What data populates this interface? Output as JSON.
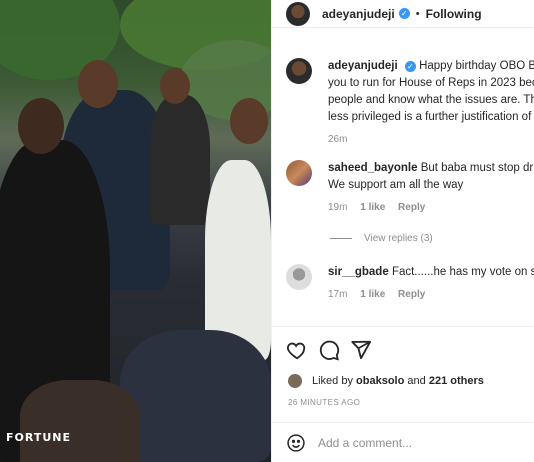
{
  "photo": {
    "watermark": "FORTUNE"
  },
  "header": {
    "username": "adeyanjudeji",
    "dot": "•",
    "follow_status": "Following"
  },
  "caption": {
    "username": "adeyanjudeji",
    "lines": [
      "Happy birthday OBO Bac",
      "you to run for House of Reps in 2023 bec",
      "people and know what the issues are. The",
      "less privileged is a further justification of"
    ],
    "time": "26m"
  },
  "comments": [
    {
      "username": "saheed_bayonle",
      "lines": [
        "But baba must stop drin",
        "We support am all the way"
      ],
      "time": "19m",
      "likes": "1 like",
      "reply": "Reply"
    },
    {
      "username": "sir__gbade",
      "lines": [
        "Fact......he has my vote on star"
      ],
      "time": "17m",
      "likes": "1 like",
      "reply": "Reply"
    }
  ],
  "view_replies": "View replies (3)",
  "likes": {
    "prefix": "Liked by",
    "user": "obaksolo",
    "connector": "and",
    "others": "221 others"
  },
  "post_time": "26 MINUTES AGO",
  "add_comment": {
    "placeholder": "Add a comment..."
  },
  "icons": [
    "heart-icon",
    "comment-icon",
    "share-icon",
    "emoji-icon",
    "verified-icon"
  ]
}
